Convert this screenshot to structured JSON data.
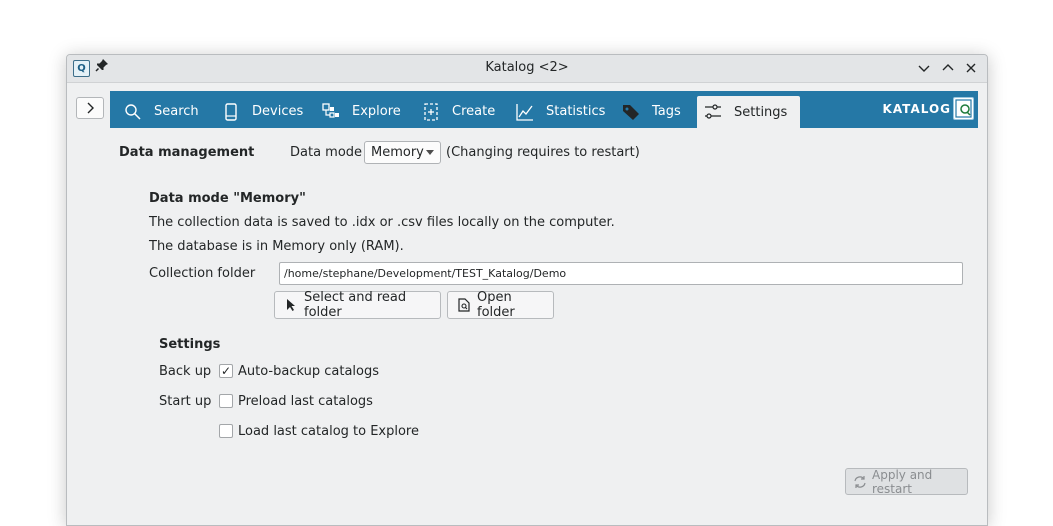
{
  "window": {
    "title": "Katalog <2>"
  },
  "tabs": [
    {
      "label": "Search",
      "icon": "search-icon"
    },
    {
      "label": "Devices",
      "icon": "device-icon"
    },
    {
      "label": "Explore",
      "icon": "explore-icon"
    },
    {
      "label": "Create",
      "icon": "create-icon"
    },
    {
      "label": "Statistics",
      "icon": "statistics-icon"
    },
    {
      "label": "Tags",
      "icon": "tag-icon"
    },
    {
      "label": "Settings",
      "icon": "settings-sliders-icon",
      "active": true
    }
  ],
  "brand": {
    "label": "KATALOG"
  },
  "data_management": {
    "heading": "Data management",
    "mode_label": "Data mode",
    "mode_value": "Memory",
    "mode_note": "(Changing requires to restart)"
  },
  "memory_section": {
    "heading": "Data mode \"Memory\"",
    "line1": "The collection data is saved to .idx or .csv files locally on the computer.",
    "line2": "The database is in Memory only (RAM).",
    "folder_label": "Collection folder",
    "folder_value": "/home/stephane/Development/TEST_Katalog/Demo",
    "select_button": "Select and read folder",
    "open_button": "Open folder"
  },
  "settings": {
    "heading": "Settings",
    "backup_label": "Back up",
    "backup_option": "Auto-backup catalogs",
    "backup_checked": true,
    "startup_label": "Start up",
    "preload_option": "Preload last catalogs",
    "preload_checked": false,
    "load_explore_option": "Load last catalog to Explore",
    "load_explore_checked": false
  },
  "apply_button": "Apply and restart",
  "colors": {
    "accent": "#2578a6",
    "window_bg": "#eff0f1"
  }
}
